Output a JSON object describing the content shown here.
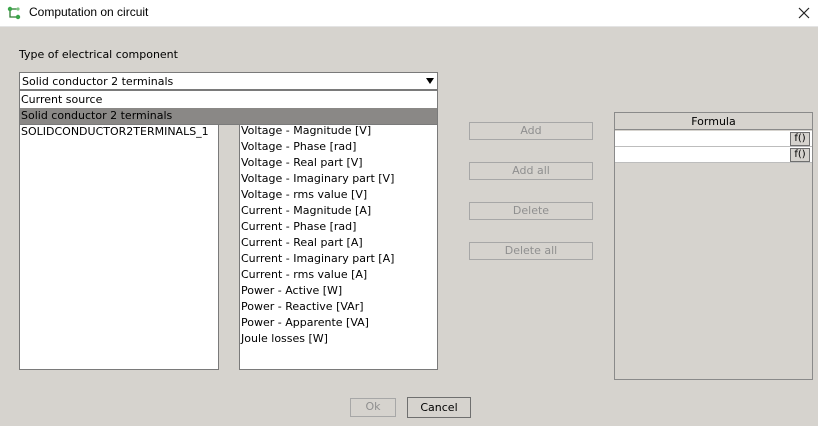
{
  "window": {
    "title": "Computation on circuit",
    "icon": "circuit-app-icon",
    "close_icon": "close-icon"
  },
  "component_type": {
    "label": "Type of electrical component",
    "selected": "Solid conductor 2 terminals",
    "options": [
      "Current source",
      "Solid conductor 2 terminals"
    ]
  },
  "components": {
    "items": [
      "SOLIDCONDUCTOR2TERMINALS_1"
    ]
  },
  "quantities": {
    "items": [
      "Voltage - Magnitude [V]",
      "Voltage - Phase [rad]",
      "Voltage - Real part [V]",
      "Voltage - Imaginary part [V]",
      "Voltage - rms value [V]",
      "Current - Magnitude [A]",
      "Current - Phase [rad]",
      "Current - Real part [A]",
      "Current - Imaginary part [A]",
      "Current - rms value [A]",
      "Power - Active [W]",
      "Power - Reactive [VAr]",
      "Power - Apparente [VA]",
      "Joule losses [W]"
    ]
  },
  "actions": {
    "add": "Add",
    "add_all": "Add all",
    "delete": "Delete",
    "delete_all": "Delete all"
  },
  "formula": {
    "header": "Formula",
    "rows": [
      {
        "value": "",
        "fx_label": "f()"
      },
      {
        "value": "",
        "fx_label": "f()"
      }
    ]
  },
  "footer": {
    "ok": "Ok",
    "cancel": "Cancel"
  }
}
